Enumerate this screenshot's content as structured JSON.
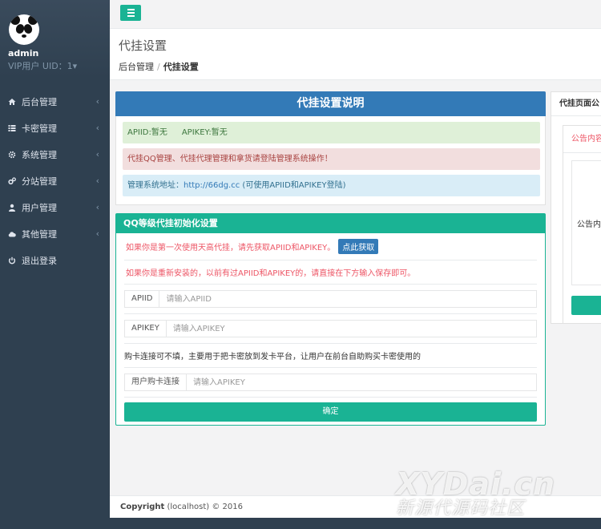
{
  "user": {
    "name": "admin",
    "uid_text": "VIP用户 UID：1▾"
  },
  "sidebar": {
    "items": [
      {
        "label": "后台管理",
        "icon": "home-icon"
      },
      {
        "label": "卡密管理",
        "icon": "list-icon"
      },
      {
        "label": "系统管理",
        "icon": "gear-icon"
      },
      {
        "label": "分站管理",
        "icon": "gears-icon"
      },
      {
        "label": "用户管理",
        "icon": "user-icon"
      },
      {
        "label": "其他管理",
        "icon": "cloud-icon"
      },
      {
        "label": "退出登录",
        "icon": "power-icon"
      }
    ]
  },
  "header": {
    "title": "代挂设置",
    "breadcrumb": {
      "home": "后台管理",
      "sep": "/",
      "current": "代挂设置"
    }
  },
  "notice": {
    "title": "代挂设置说明",
    "apiid": "APIID:暂无",
    "apikey": "APIKEY:暂无",
    "warning": "代挂QQ管理、代挂代理管理和拿货请登陆管理系统操作！",
    "address_prefix": "管理系统地址：",
    "address_link": "http://66dg.cc",
    "address_suffix": " (可使用APIID和APIKEY登陆)"
  },
  "form": {
    "title": "QQ等级代挂初始化设置",
    "first_time": "如果你是第一次使用天高代挂，请先获取APIID和APIKEY。",
    "get_button": "点此获取",
    "reinstall": "如果你是重新安装的，以前有过APIID和APIKEY的，请直接在下方输入保存即可。",
    "apiid_label": "APIID",
    "apiid_placeholder": "请输入APIID",
    "apikey_label": "APIKEY",
    "apikey_placeholder": "请输入APIKEY",
    "note": "购卡连接可不填，主要用于把卡密放到发卡平台，让用户在前台自助购买卡密使用的",
    "buy_label": "用户购卡连接",
    "buy_placeholder": "请输入APIKEY",
    "submit": "确定"
  },
  "right_panel": {
    "title": "代挂页面公",
    "sub": "公告内容",
    "box_label": "公告内"
  },
  "footer": {
    "brand": "Copyright",
    "text": " (localhost) © 2016"
  },
  "watermark": {
    "line1": "XYDai.cn",
    "line2": "新源代源码社区"
  },
  "colors": {
    "sidebar": "#2f4050",
    "accent": "#1ab394",
    "primary": "#337ab7",
    "danger": "#ed5565"
  }
}
